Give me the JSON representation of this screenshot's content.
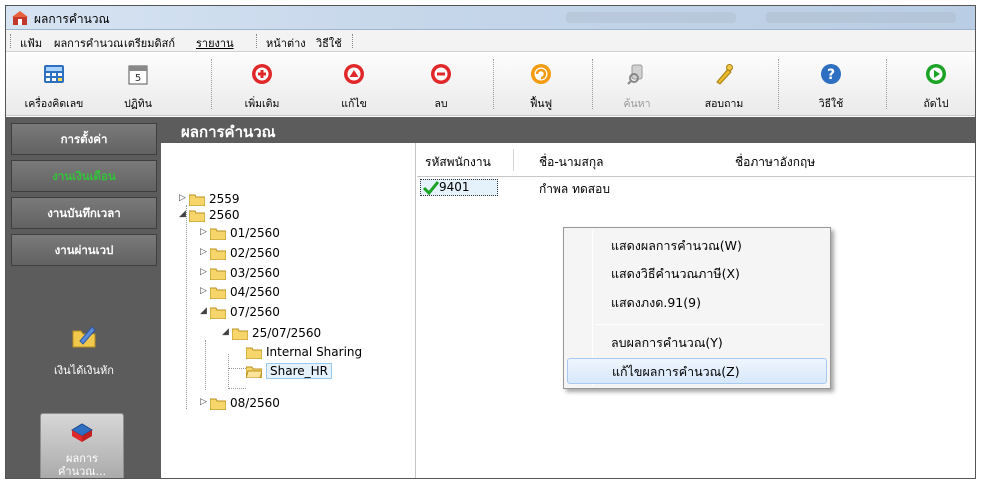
{
  "window": {
    "title": "ผลการคำนวณ"
  },
  "menu": [
    "แฟ้ม",
    "ผลการคำนวณ",
    "เตรียมดิสก์",
    "รายงาน",
    "หน้าต่าง",
    "วิธีใช้"
  ],
  "toolbar": [
    {
      "label": "เครื่องคิดเลข",
      "icon": "calculator-icon"
    },
    {
      "label": "ปฏิทิน",
      "icon": "calendar-icon"
    },
    {
      "label": "เพิ่มเติม",
      "icon": "add-icon"
    },
    {
      "label": "แก้ไข",
      "icon": "edit-icon"
    },
    {
      "label": "ลบ",
      "icon": "delete-icon"
    },
    {
      "label": "ฟื้นฟู",
      "icon": "restore-icon"
    },
    {
      "label": "ค้นหา",
      "icon": "search-icon"
    },
    {
      "label": "สอบถาม",
      "icon": "query-icon"
    },
    {
      "label": "วิธีใช้",
      "icon": "help-icon"
    },
    {
      "label": "ถัดไป",
      "icon": "next-icon"
    }
  ],
  "nav": {
    "items": [
      "การตั้งค่า",
      "งานเงินเดือน",
      "งานบันทึกเวลา",
      "งานผ่านเวป"
    ],
    "income_deduction": "เงินได้เงินหัก",
    "calc_result_line1": "ผลการ",
    "calc_result_line2": "คำนวณ..."
  },
  "content": {
    "title": "ผลการคำนวณ"
  },
  "tree": {
    "y2559": "2559",
    "y2560": "2560",
    "m01": "01/2560",
    "m02": "02/2560",
    "m03": "03/2560",
    "m04": "04/2560",
    "m07": "07/2560",
    "d250760": "25/07/2560",
    "internal": "Internal Sharing",
    "share_hr": "Share_HR",
    "m08": "08/2560"
  },
  "list": {
    "columns": [
      "รหัสพนักงาน",
      "ชื่อ-นามสกุล",
      "ชื่อภาษาอังกฤษ"
    ],
    "rows": [
      {
        "id": "9401",
        "name": "กำพล ทดสอบ",
        "name_en": ""
      }
    ]
  },
  "context_menu": {
    "items": [
      "แสดงผลการคำนวณ(W)",
      "แสดงวิธีคำนวณภาษี(X)",
      "แสดงภงด.91(9)",
      "ลบผลการคำนวณ(Y)",
      "แก้ไขผลการคำนวณ(Z)"
    ]
  },
  "colors": {
    "active_nav": "#34c13b",
    "panel_bg": "#5c5c5c",
    "accent_red": "#e0282a",
    "accent_green": "#1aa325"
  }
}
